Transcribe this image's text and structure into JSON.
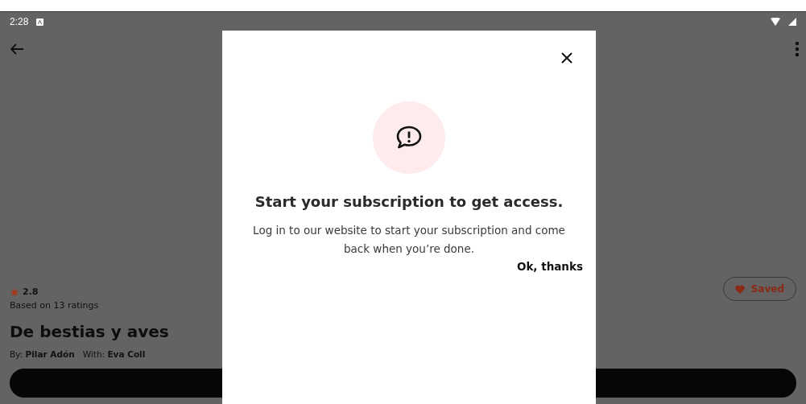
{
  "status_bar": {
    "time": "2:28"
  },
  "book": {
    "rating": "2.8",
    "ratings_count": "Based on 13 ratings",
    "title": "De bestias y aves",
    "credits": "By: **Pilar Adón**   With: **Eva Coll**",
    "saved_button": {
      "label": "Saved"
    }
  },
  "dialog": {
    "title": "Start your subscription to get access.",
    "message": "Log in to our website to start your subscription and come back when you’re done.",
    "action": "Ok, thanks"
  }
}
